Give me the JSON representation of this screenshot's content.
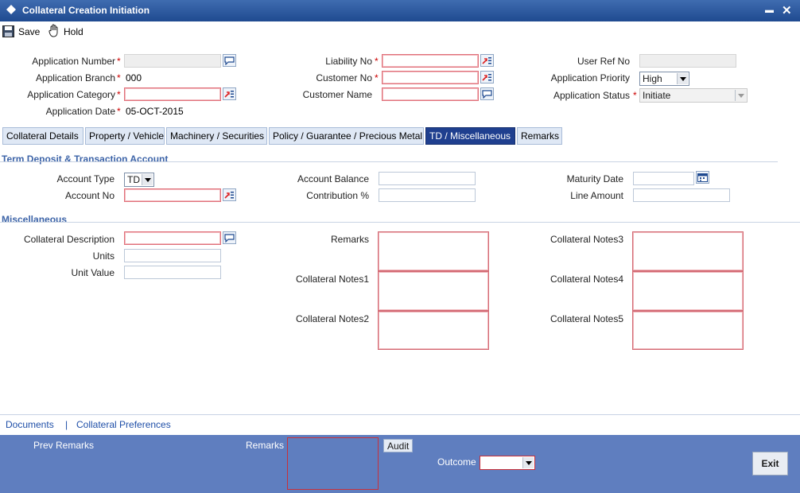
{
  "window": {
    "title": "Collateral Creation Initiation",
    "minimize": "▬",
    "close": "✕"
  },
  "toolbar": {
    "save": "Save",
    "hold": "Hold"
  },
  "header": {
    "application_number": {
      "label": "Application Number",
      "value": ""
    },
    "application_branch": {
      "label": "Application Branch",
      "value": "000"
    },
    "application_category": {
      "label": "Application Category",
      "value": ""
    },
    "application_date": {
      "label": "Application Date",
      "value": "05-OCT-2015"
    },
    "liability_no": {
      "label": "Liability No",
      "value": ""
    },
    "customer_no": {
      "label": "Customer No",
      "value": ""
    },
    "customer_name": {
      "label": "Customer Name",
      "value": ""
    },
    "user_ref_no": {
      "label": "User Ref No",
      "value": ""
    },
    "application_priority": {
      "label": "Application Priority",
      "value": "High"
    },
    "application_status": {
      "label": "Application Status",
      "value": "Initiate"
    },
    "required_marker": "*"
  },
  "tabs": [
    {
      "label": "Collateral Details",
      "active": false
    },
    {
      "label": "Property / Vehicle",
      "active": false
    },
    {
      "label": "Machinery / Securities",
      "active": false
    },
    {
      "label": "Policy / Guarantee / Precious Metal",
      "active": false
    },
    {
      "label": "TD / Miscellaneous",
      "active": true
    },
    {
      "label": "Remarks",
      "active": false
    }
  ],
  "term_deposit": {
    "title": "Term Deposit & Transaction Account",
    "account_type": {
      "label": "Account Type",
      "value": "TD"
    },
    "account_no": {
      "label": "Account No",
      "value": ""
    },
    "account_balance": {
      "label": "Account Balance",
      "value": ""
    },
    "contribution": {
      "label": "Contribution %",
      "value": ""
    },
    "maturity_date": {
      "label": "Maturity Date",
      "value": ""
    },
    "line_amount": {
      "label": "Line Amount",
      "value": ""
    }
  },
  "misc": {
    "title": "Miscellaneous",
    "collateral_description": {
      "label": "Collateral Description",
      "value": ""
    },
    "units": {
      "label": "Units",
      "value": ""
    },
    "unit_value": {
      "label": "Unit Value",
      "value": ""
    },
    "remarks": {
      "label": "Remarks"
    },
    "notes1": {
      "label": "Collateral Notes1"
    },
    "notes2": {
      "label": "Collateral Notes2"
    },
    "notes3": {
      "label": "Collateral Notes3"
    },
    "notes4": {
      "label": "Collateral Notes4"
    },
    "notes5": {
      "label": "Collateral Notes5"
    }
  },
  "links": {
    "documents": "Documents",
    "separator": "|",
    "collateral_preferences": "Collateral Preferences"
  },
  "footer": {
    "prev_remarks": "Prev Remarks",
    "remarks": "Remarks",
    "audit": "Audit",
    "outcome": "Outcome",
    "outcome_value": "",
    "exit": "Exit"
  },
  "colors": {
    "titlebar": "#1f4a90",
    "active_tab": "#1f3f8f",
    "footer": "#5f7ebf",
    "section": "#3d64a8",
    "mandatory_border": "#e0707a"
  }
}
